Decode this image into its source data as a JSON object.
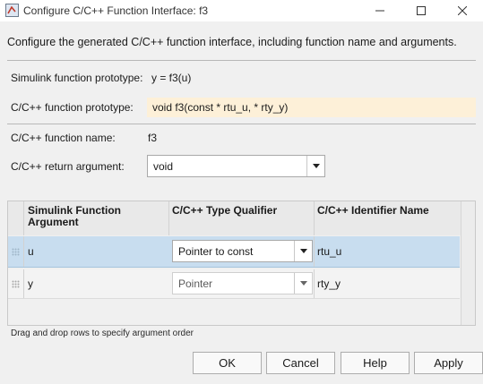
{
  "window": {
    "title": "Configure C/C++ Function Interface: f3",
    "icons": [
      "app-icon",
      "minimize-icon",
      "maximize-icon",
      "close-icon"
    ]
  },
  "instructions": "Configure the generated C/C++ function interface, including function name and arguments.",
  "fields": {
    "simulink_prototype_label": "Simulink function prototype:",
    "simulink_prototype_value": "y = f3(u)",
    "c_prototype_label": "C/C++ function prototype:",
    "c_prototype_value": "void f3(const * rtu_u, * rty_y)",
    "c_function_name_label": "C/C++ function name:",
    "c_function_name_value": "f3",
    "c_return_label": "C/C++ return argument:",
    "c_return_value": "void"
  },
  "table": {
    "headers": [
      "Simulink Function Argument",
      "C/C++ Type Qualifier",
      "C/C++ Identifier Name"
    ],
    "rows": [
      {
        "argument": "u",
        "qualifier": "Pointer to const",
        "identifier": "rtu_u",
        "selected": true
      },
      {
        "argument": "y",
        "qualifier": "Pointer",
        "identifier": "rty_y",
        "selected": false
      }
    ]
  },
  "hint": "Drag and drop rows to specify argument order",
  "buttons": {
    "ok": "OK",
    "cancel": "Cancel",
    "help": "Help",
    "apply": "Apply"
  },
  "colors": {
    "prototype_highlight": "#fdf0d8",
    "selected_row": "#c8ddef"
  }
}
